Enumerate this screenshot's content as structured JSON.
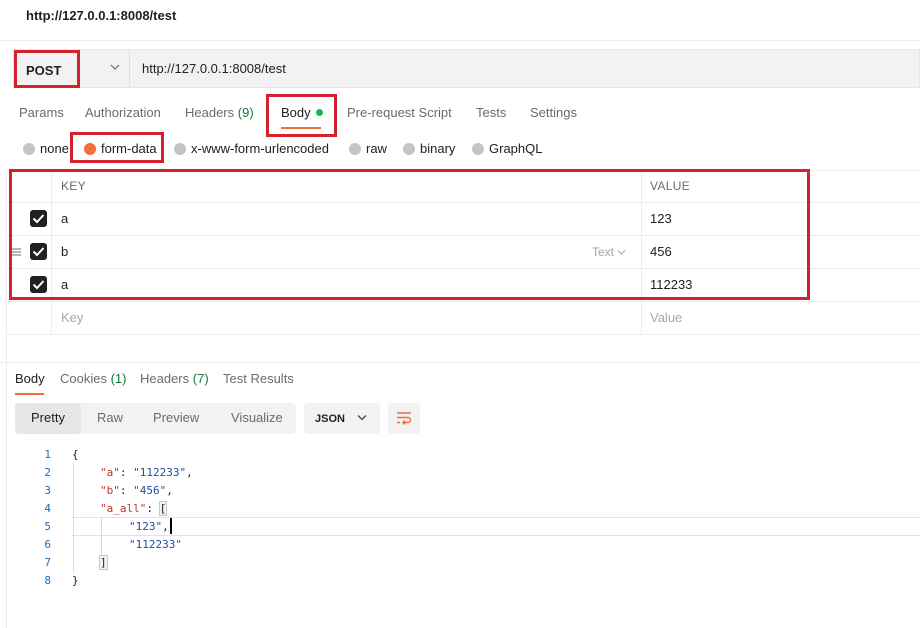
{
  "title": "http://127.0.0.1:8008/test",
  "request": {
    "method": "POST",
    "url": "http://127.0.0.1:8008/test"
  },
  "tabs": [
    {
      "label": "Params"
    },
    {
      "label": "Authorization"
    },
    {
      "label": "Headers",
      "count": "(9)"
    },
    {
      "label": "Body"
    },
    {
      "label": "Pre-request Script"
    },
    {
      "label": "Tests"
    },
    {
      "label": "Settings"
    }
  ],
  "body_types": [
    "none",
    "form-data",
    "x-www-form-urlencoded",
    "raw",
    "binary",
    "GraphQL"
  ],
  "body_type_selected": "form-data",
  "table": {
    "headers": {
      "key": "KEY",
      "value": "VALUE"
    },
    "rows": [
      {
        "key": "a",
        "value": "123",
        "checked": true
      },
      {
        "key": "b",
        "value": "456",
        "checked": true,
        "type": "Text"
      },
      {
        "key": "a",
        "value": "112233",
        "checked": true
      }
    ],
    "placeholder": {
      "key": "Key",
      "value": "Value"
    }
  },
  "response_tabs": [
    {
      "label": "Body"
    },
    {
      "label": "Cookies",
      "count": "(1)"
    },
    {
      "label": "Headers",
      "count": "(7)"
    },
    {
      "label": "Test Results"
    }
  ],
  "view_modes": [
    "Pretty",
    "Raw",
    "Preview",
    "Visualize"
  ],
  "format": "JSON",
  "code_lines": [
    {
      "n": "1",
      "text": "{"
    },
    {
      "n": "2",
      "key": "\"a\"",
      "sep": ": ",
      "val": "\"112233\"",
      "end": ","
    },
    {
      "n": "3",
      "key": "\"b\"",
      "sep": ": ",
      "val": "\"456\"",
      "end": ","
    },
    {
      "n": "4",
      "key": "\"a_all\"",
      "sep": ": ",
      "text_after": "["
    },
    {
      "n": "5",
      "val": "\"123\"",
      "end": ","
    },
    {
      "n": "6",
      "val": "\"112233\""
    },
    {
      "n": "7",
      "text": "]"
    },
    {
      "n": "8",
      "text": "}"
    }
  ],
  "colors": {
    "accent": "#f26b3a",
    "highlight": "#d5202e",
    "success": "#0cbb52"
  }
}
